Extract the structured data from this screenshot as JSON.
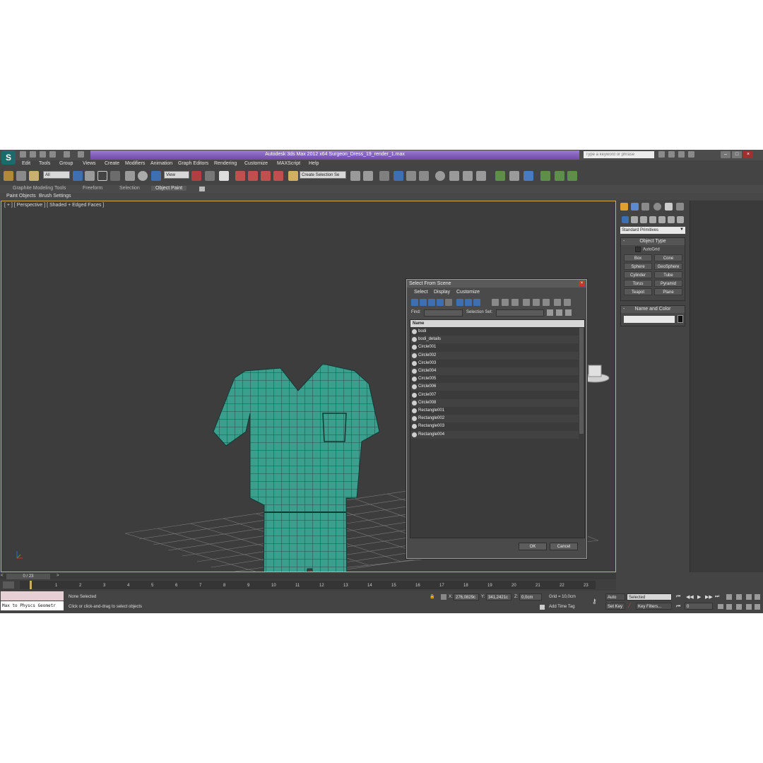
{
  "title_bar": {
    "title": "Autodesk 3ds Max  2012 x64     Surgeon_Dress_19_render_1.max",
    "search_placeholder": "Type a keyword or phrase",
    "logo": "S"
  },
  "menu": [
    "Edit",
    "Tools",
    "Group",
    "Views",
    "Create",
    "Modifiers",
    "Animation",
    "Graph Editors",
    "Rendering",
    "Customize",
    "MAXScript",
    "Help"
  ],
  "toolbar": {
    "selection_filter": "All",
    "ref_coord": "View",
    "named_selection": "Create Selection Se"
  },
  "ribbon": {
    "tabs": [
      "Graphite Modeling Tools",
      "Freeform",
      "Selection",
      "Object Paint"
    ],
    "active_tab": "Object Paint",
    "sub_items": [
      "Paint Objects",
      "Brush Settings"
    ]
  },
  "viewport": {
    "label": "[ + ] [ Perspective ] [ Shaded + Edged Faces ]"
  },
  "command_panel": {
    "category": "Standard Primitives",
    "object_type": {
      "header": "Object Type",
      "autogrid": "AutoGrid",
      "buttons": [
        "Box",
        "Cone",
        "Sphere",
        "GeoSphere",
        "Cylinder",
        "Tube",
        "Torus",
        "Pyramid",
        "Teapot",
        "Plane"
      ]
    },
    "name_color": {
      "header": "Name and Color"
    }
  },
  "timeline": {
    "frame_display": "0 / 23",
    "ticks": [
      "0",
      "1",
      "2",
      "3",
      "4",
      "5",
      "6",
      "7",
      "8",
      "9",
      "10",
      "11",
      "12",
      "13",
      "14",
      "15",
      "16",
      "17",
      "18",
      "19",
      "20",
      "21",
      "22",
      "23"
    ]
  },
  "status": {
    "maxscript_line": "Max to Physcs Geometr",
    "selection": "None Selected",
    "prompt": "Click or click-and-drag to select objects",
    "x_label": "X:",
    "x": "276,0829c",
    "y_label": "Y:",
    "y": "341,2421c",
    "z_label": "Z:",
    "z": "0,0cm",
    "grid": "Grid = 10,0cm",
    "add_time_tag": "Add Time Tag",
    "auto_key": "Auto Key",
    "set_key": "Set Key",
    "key_mode": "Selected",
    "key_filters": "Key Filters...",
    "frame": "0"
  },
  "dialog": {
    "title": "Select From Scene",
    "menu": [
      "Select",
      "Display",
      "Customize"
    ],
    "find_label": "Find:",
    "selection_set_label": "Selection Set:",
    "column_header": "Name",
    "items": [
      "bodi",
      "bodi_details",
      "Circle001",
      "Circle002",
      "Circle003",
      "Circle004",
      "Circle005",
      "Circle006",
      "Circle007",
      "Circle008",
      "Rectangle001",
      "Rectangle002",
      "Rectangle003",
      "Rectangle004"
    ],
    "ok_label": "OK",
    "cancel_label": "Cancel"
  },
  "colors": {
    "title_accent": "#7e5cb8",
    "viewport_border": "#d6b04a",
    "mesh": "#3a9f8c"
  }
}
